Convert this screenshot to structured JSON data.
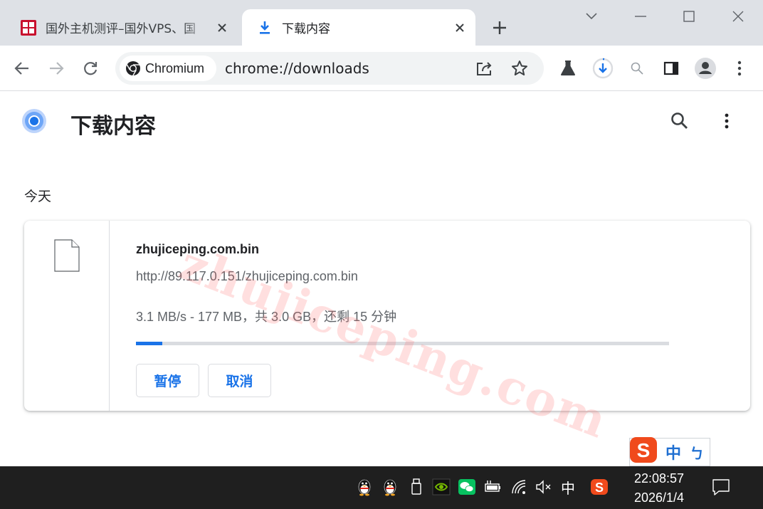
{
  "tabs": [
    {
      "title": "国外主机测评–国外VPS、国",
      "active": false,
      "favicon": "site-seal-icon"
    },
    {
      "title": "下载内容",
      "active": true,
      "favicon": "download-arrow-icon"
    }
  ],
  "omnibox": {
    "chip_label": "Chromium",
    "url": "chrome://downloads"
  },
  "page": {
    "title": "下载内容",
    "section_date": "今天"
  },
  "watermark": "zhujiceping.com",
  "download": {
    "file_name": "zhujiceping.com.bin",
    "url": "http://89.117.0.151/zhujiceping.com.bin",
    "status": "3.1 MB/s - 177 MB，共 3.0 GB，还剩 15 分钟",
    "progress_fraction": 0.05,
    "pause_label": "暂停",
    "cancel_label": "取消"
  },
  "ime": {
    "mode": "中",
    "punct": "ㄅ"
  },
  "taskbar": {
    "ime_indicator": "中",
    "time": "22:08:57",
    "date": "2026/1/4"
  },
  "colors": {
    "accent": "#1a73e8",
    "tabstrip": "#dee1e6",
    "taskbar": "#1f1f1f"
  }
}
